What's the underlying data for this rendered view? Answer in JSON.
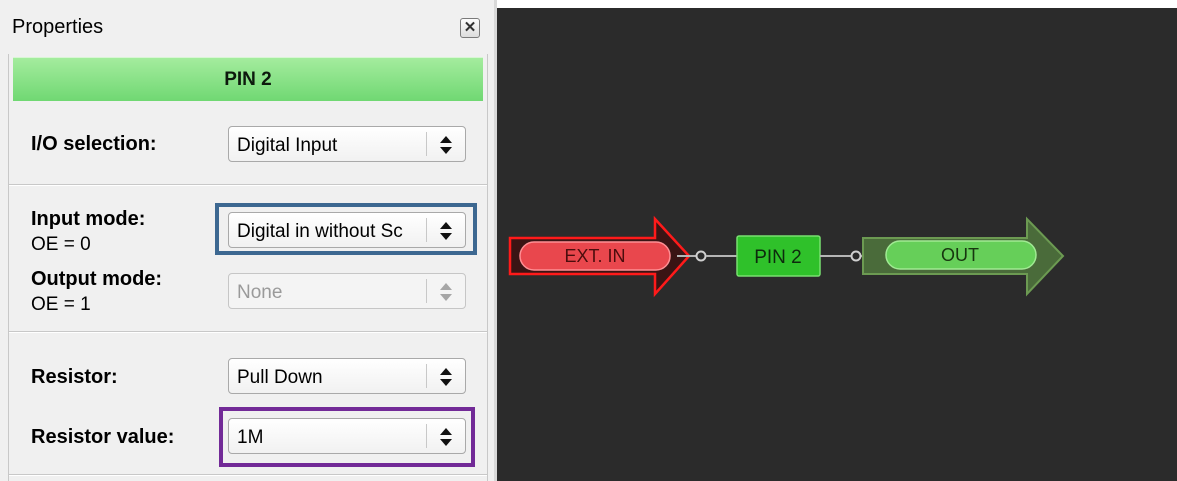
{
  "panel": {
    "title": "Properties",
    "close_glyph": "✕",
    "pin_bar_label": "PIN 2"
  },
  "io_selection": {
    "label": "I/O selection:",
    "value": "Digital Input"
  },
  "input_mode": {
    "label": "Input mode:",
    "sublabel": "OE = 0",
    "value": "Digital in without Sc"
  },
  "output_mode": {
    "label": "Output mode:",
    "sublabel": "OE = 1",
    "value": "None",
    "disabled": true
  },
  "resistor": {
    "label": "Resistor:",
    "value": "Pull Down"
  },
  "resistor_value": {
    "label": "Resistor value:",
    "value": "1M"
  },
  "canvas": {
    "ext_in_label": "EXT. IN",
    "pin_label": "PIN 2",
    "out_label": "OUT"
  },
  "colors": {
    "canvas_bg": "#2b2b2b",
    "highlight_blue": "#3d6891",
    "highlight_purple": "#722a97",
    "ext_in_red": "#e8454a",
    "out_green": "#55a63a",
    "pin_green": "#2fc12a"
  }
}
